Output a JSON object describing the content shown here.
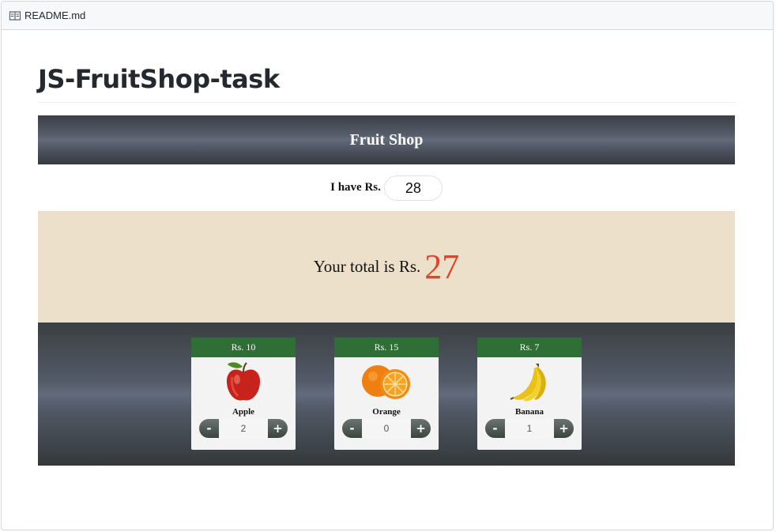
{
  "file_header": {
    "filename": "README.md",
    "icon": "book-icon"
  },
  "heading": "JS-FruitShop-task",
  "shop": {
    "title": "Fruit Shop",
    "budget_label": "I have Rs.",
    "budget_value": "28",
    "total_label": "Your total is Rs.",
    "total_value": "27",
    "colors": {
      "total": "#e0442e",
      "price_tag": "#2f6f35",
      "total_panel": "#ede0cb"
    },
    "fruits": [
      {
        "price": "Rs. 10",
        "name": "Apple",
        "qty": "2",
        "icon": "apple-icon",
        "minus": "-",
        "plus": "+"
      },
      {
        "price": "Rs. 15",
        "name": "Orange",
        "qty": "0",
        "icon": "orange-icon",
        "minus": "-",
        "plus": "+"
      },
      {
        "price": "Rs. 7",
        "name": "Banana",
        "qty": "1",
        "icon": "banana-icon",
        "minus": "-",
        "plus": "+"
      }
    ]
  }
}
